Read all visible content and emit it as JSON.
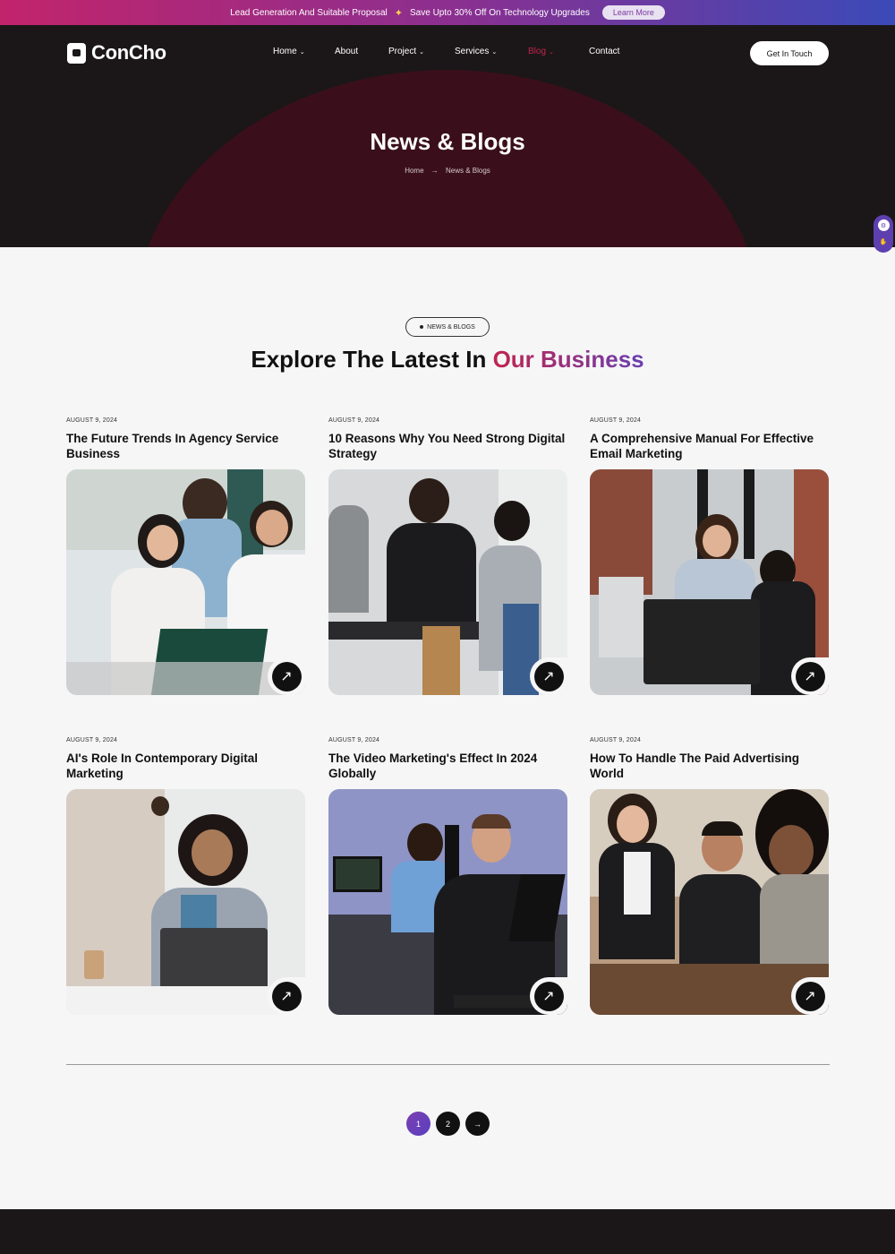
{
  "promo": {
    "text_left": "Lead Generation And Suitable Proposal",
    "spark_icon": "sparkle-icon",
    "text_right": "Save Upto 30% Off On Technology Upgrades",
    "button_label": "Learn More"
  },
  "brand": {
    "name": "ConCho"
  },
  "nav": {
    "items": [
      {
        "label": "Home",
        "has_dropdown": true
      },
      {
        "label": "About",
        "has_dropdown": false
      },
      {
        "label": "Project",
        "has_dropdown": true
      },
      {
        "label": "Services",
        "has_dropdown": true
      },
      {
        "label": "Blog",
        "has_dropdown": true
      },
      {
        "label": "Contact",
        "has_dropdown": false
      }
    ],
    "dropdown_glyph": "⌄",
    "cta_label": "Get In Touch"
  },
  "hero": {
    "title": "News & Blogs",
    "breadcrumb": {
      "home": "Home",
      "separator": "→",
      "current": "News & Blogs"
    }
  },
  "section": {
    "tag": "NEWS & BLOGS",
    "title_plain": "Explore The Latest In",
    "title_accent": "Our Business"
  },
  "posts": [
    {
      "date": "AUGUST 9, 2024",
      "title": "The Future Trends In Agency Service Business"
    },
    {
      "date": "AUGUST 9, 2024",
      "title": "10 Reasons Why You Need Strong Digital Strategy"
    },
    {
      "date": "AUGUST 9, 2024",
      "title": "A Comprehensive Manual For Effective Email Marketing"
    },
    {
      "date": "AUGUST 9, 2024",
      "title": "AI's Role In Contemporary Digital Marketing"
    },
    {
      "date": "AUGUST 9, 2024",
      "title": "The Video Marketing's Effect In 2024 Globally"
    },
    {
      "date": "AUGUST 9, 2024",
      "title": "How To Handle The Paid Advertising World"
    }
  ],
  "arrow_glyph": "↗",
  "pagination": {
    "pages": [
      "1",
      "2"
    ],
    "current": "1",
    "next_glyph": "→"
  },
  "colors": {
    "accent_red": "#c1244f",
    "accent_purple": "#6a3fb0",
    "dark": "#1b1718"
  }
}
